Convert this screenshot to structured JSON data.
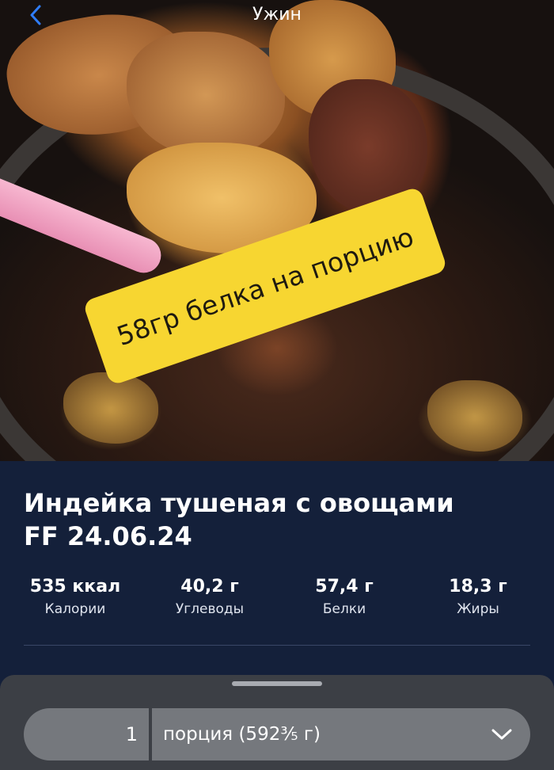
{
  "header": {
    "title": "Ужин",
    "back_icon": "chevron-left-icon",
    "back_color": "#2f7cf6"
  },
  "photo": {
    "sticker_text": "58гр белка на порцию",
    "sticker_color": "#f7d631"
  },
  "dish": {
    "title_line1": "Индейка тушеная с овощами",
    "title_line2": "FF 24.06.24"
  },
  "macros": [
    {
      "value": "535 ккал",
      "label": "Калории"
    },
    {
      "value": "40,2 г",
      "label": "Углеводы"
    },
    {
      "value": "57,4 г",
      "label": "Белки"
    },
    {
      "value": "18,3 г",
      "label": "Жиры"
    }
  ],
  "portion": {
    "quantity": "1",
    "unit": "порция (592³⁄₅ г)",
    "dropdown_icon": "chevron-down-icon"
  }
}
